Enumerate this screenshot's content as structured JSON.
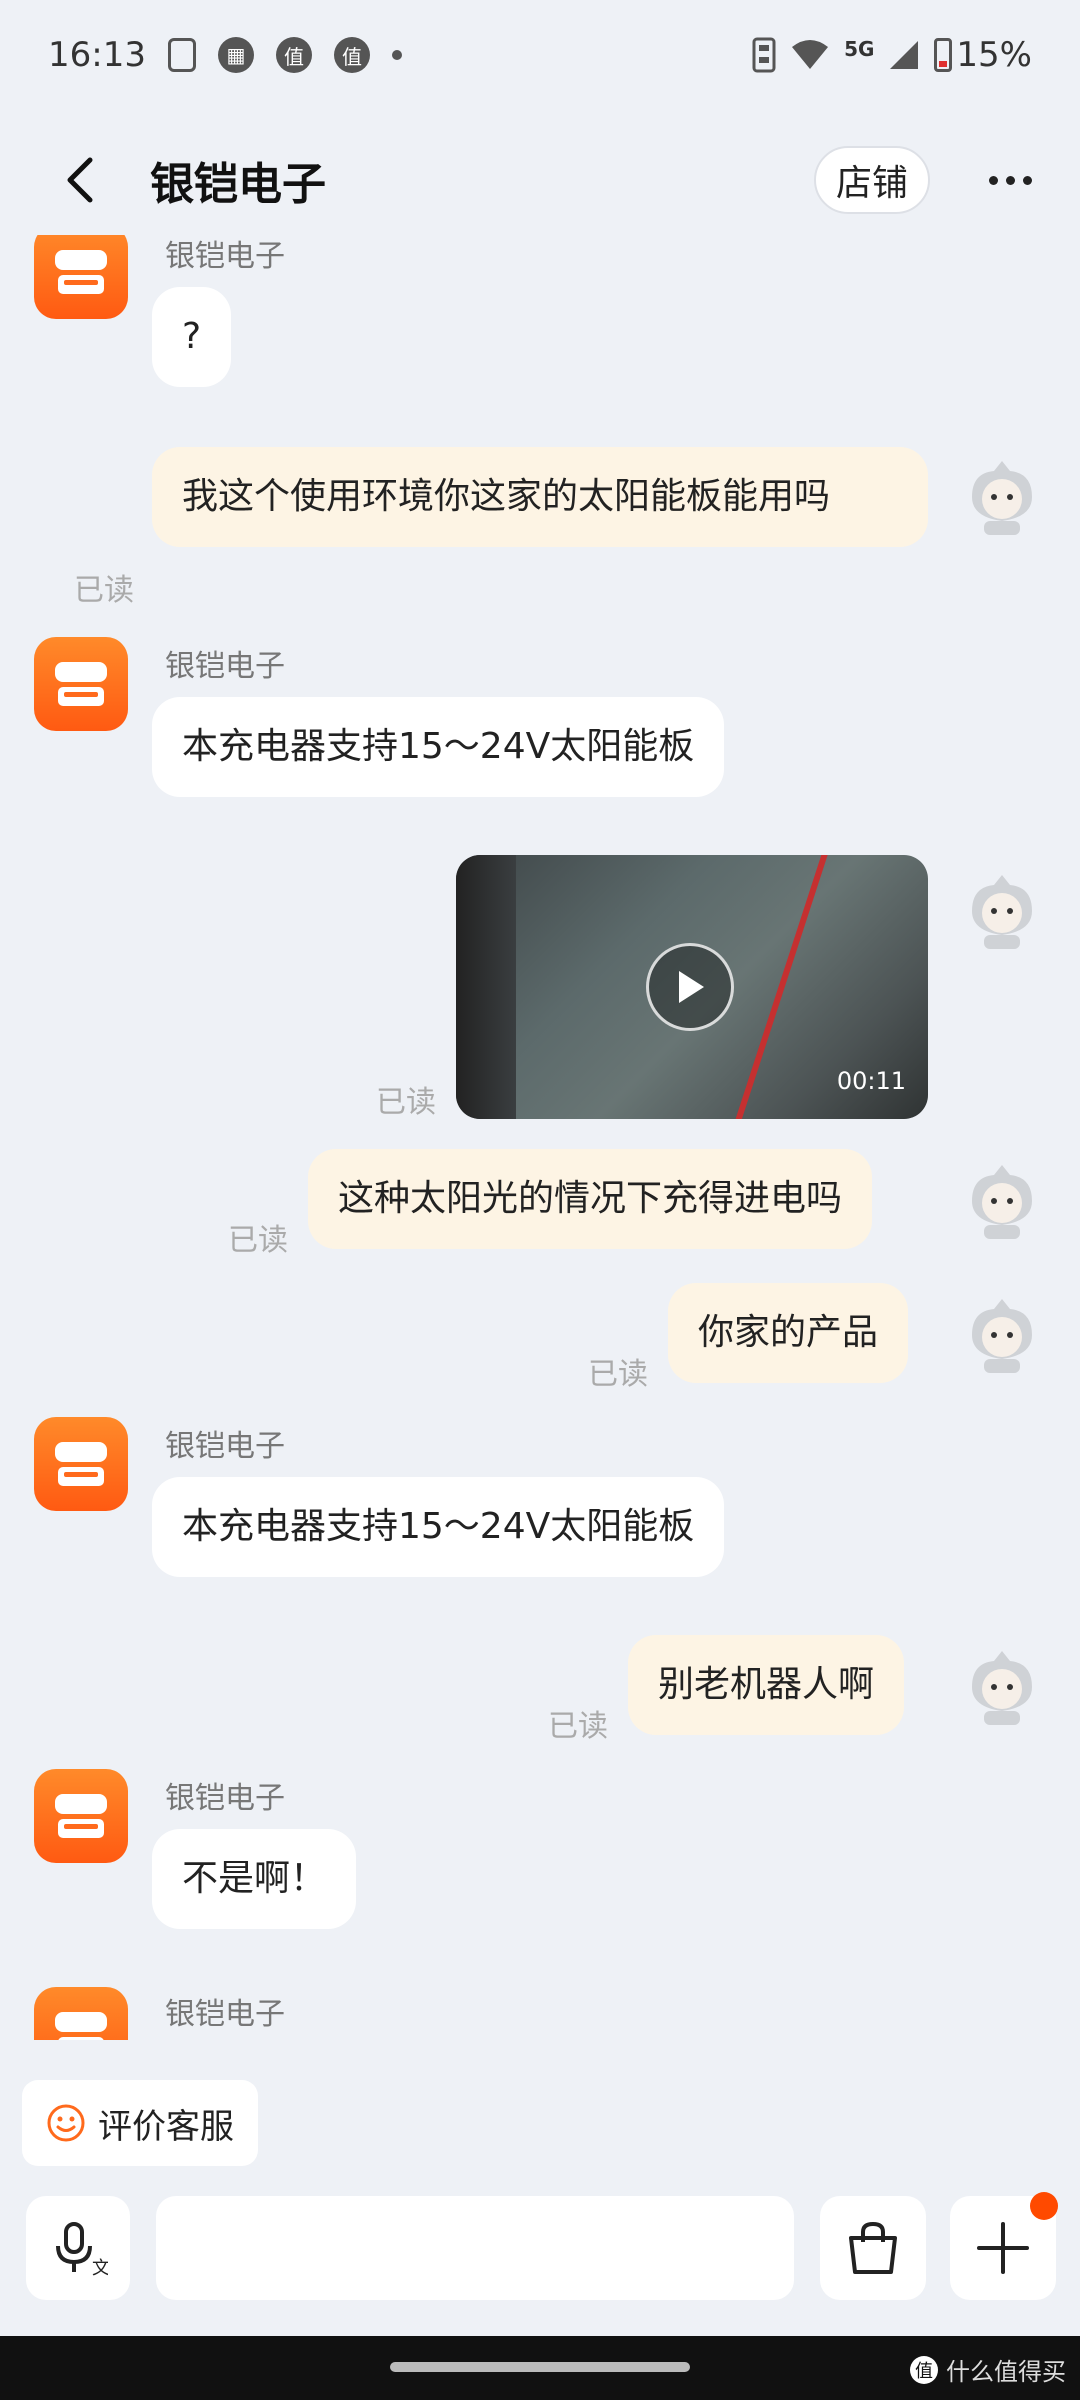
{
  "status_bar": {
    "time": "16:13",
    "notif_icons": [
      "battery-saver-icon",
      "calendar-icon",
      "zhi-app-icon",
      "zhi-app-icon"
    ],
    "zhi_glyph": "值",
    "network": "5G",
    "battery": "15%"
  },
  "header": {
    "title": "银铠电子",
    "shop_label": "店铺"
  },
  "messages": {
    "shop_name": "银铠电子",
    "read_label": "已读",
    "m1": "?",
    "m2": "我这个使用环境你这家的太阳能板能用吗",
    "m3": "本充电器支持15～24V太阳能板",
    "video_duration": "00:11",
    "m5": "这种太阳光的情况下充得进电吗",
    "m6": "你家的产品",
    "m7": "本充电器支持15～24V太阳能板",
    "m8": "别老机器人啊",
    "m9": "不是啊！"
  },
  "rate_button": {
    "label": "评价客服"
  },
  "input_bar": {
    "voice_glyph": "文"
  },
  "watermark": {
    "text": "什么值得买",
    "glyph": "值"
  },
  "colors": {
    "accent": "#ff5a12",
    "out_bubble": "#fdf4e4",
    "in_bubble": "#ffffff",
    "badge": "#ff4a00"
  }
}
